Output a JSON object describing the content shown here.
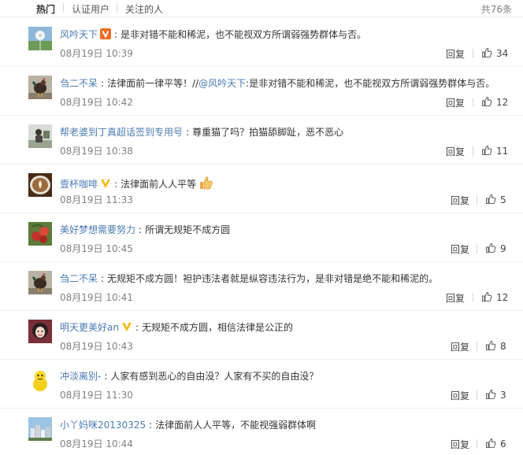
{
  "tabs": [
    {
      "label": "热门",
      "active": true
    },
    {
      "label": "认证用户",
      "active": false
    },
    {
      "label": "关注的人",
      "active": false
    }
  ],
  "total": "共76条",
  "reply_label": "回复",
  "colors": {
    "link": "#4b7bb2",
    "vip_orange": "#f06b20",
    "vip_yellow": "#f7b500",
    "muted": "#808080"
  },
  "comments": [
    {
      "user": "风吟天下",
      "badge": "orange-v-badge",
      "text": "是非对错不能和稀泥，也不能视双方所谓弱强势群体与否。",
      "date": "08月19日 10:39",
      "likes": "34",
      "avatar": "dandelion"
    },
    {
      "user": "刍二不呆",
      "text": "法律面前一律平等！//",
      "mention": "@风吟天下",
      "text2": ":是非对错不能和稀泥，也不能视双方所谓弱强势群体与否。",
      "date": "08月19日 10:42",
      "likes": "12",
      "avatar": "rooster"
    },
    {
      "user": "帮老婆到丁真超话签到专用号",
      "text": "尊重猫了吗？拍猫舔脚趾，恶不恶心",
      "date": "08月19日 10:38",
      "likes": "11",
      "avatar": "person"
    },
    {
      "user": "壹杯咖啡",
      "badge": "yellow-v-badge",
      "text": "法律面前人人平等",
      "emoji": "thumbs-up-emoji",
      "date": "08月19日 11:33",
      "likes": "5",
      "avatar": "coffee"
    },
    {
      "user": "美好梦想需要努力",
      "text": "所谓无规矩不成方圆",
      "date": "08月19日 10:45",
      "likes": "9",
      "avatar": "fruit"
    },
    {
      "user": "刍二不呆",
      "text": "无规矩不成方圆！袒护违法者就是纵容违法行为，是非对错是绝不能和稀泥的。",
      "date": "08月19日 10:41",
      "likes": "12",
      "avatar": "rooster"
    },
    {
      "user": "明天更美好an",
      "badge": "yellow-v-badge",
      "text": "无规矩不成方圆，相信法律是公正的",
      "date": "08月19日 10:43",
      "likes": "8",
      "avatar": "girl"
    },
    {
      "user": "冲淡离别-",
      "text": "人家有感到恶心的自由没？人家有不买的自由没？",
      "date": "08月19日 11:30",
      "likes": "3",
      "avatar": "yellow"
    },
    {
      "user": "小丫妈咪20130325",
      "text": "法律面前人人平等，不能视强弱群体啊",
      "date": "08月19日 10:44",
      "likes": "6",
      "avatar": "city"
    }
  ]
}
